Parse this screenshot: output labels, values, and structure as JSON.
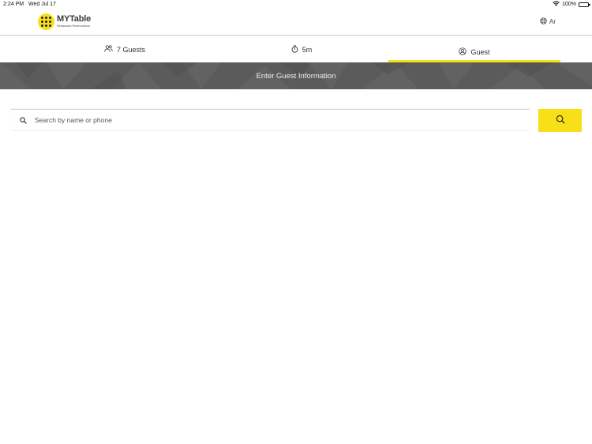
{
  "status_bar": {
    "time": "2:24 PM",
    "date": "Wed Jul 17",
    "battery": "100%",
    "icons": [
      "wifi-icon",
      "battery-icon"
    ]
  },
  "header": {
    "logo": {
      "name": "MYTable",
      "tagline": "Restaurant Reservations",
      "brand_color": "#f7e017"
    },
    "language": {
      "label": "Ar",
      "icon": "globe-icon"
    }
  },
  "tabs": [
    {
      "label": "7 Guests",
      "icon": "people-icon"
    },
    {
      "label": "5m",
      "icon": "stopwatch-icon"
    },
    {
      "label": "Guest",
      "icon": "user-circle-icon",
      "active": true
    }
  ],
  "banner": {
    "title": "Enter Guest Information",
    "color": "#5b5b5b"
  },
  "search": {
    "placeholder": "Search by name or phone",
    "value": "",
    "icon": "search-icon",
    "button_icon": "search-icon",
    "button_color": "#f7e017"
  }
}
